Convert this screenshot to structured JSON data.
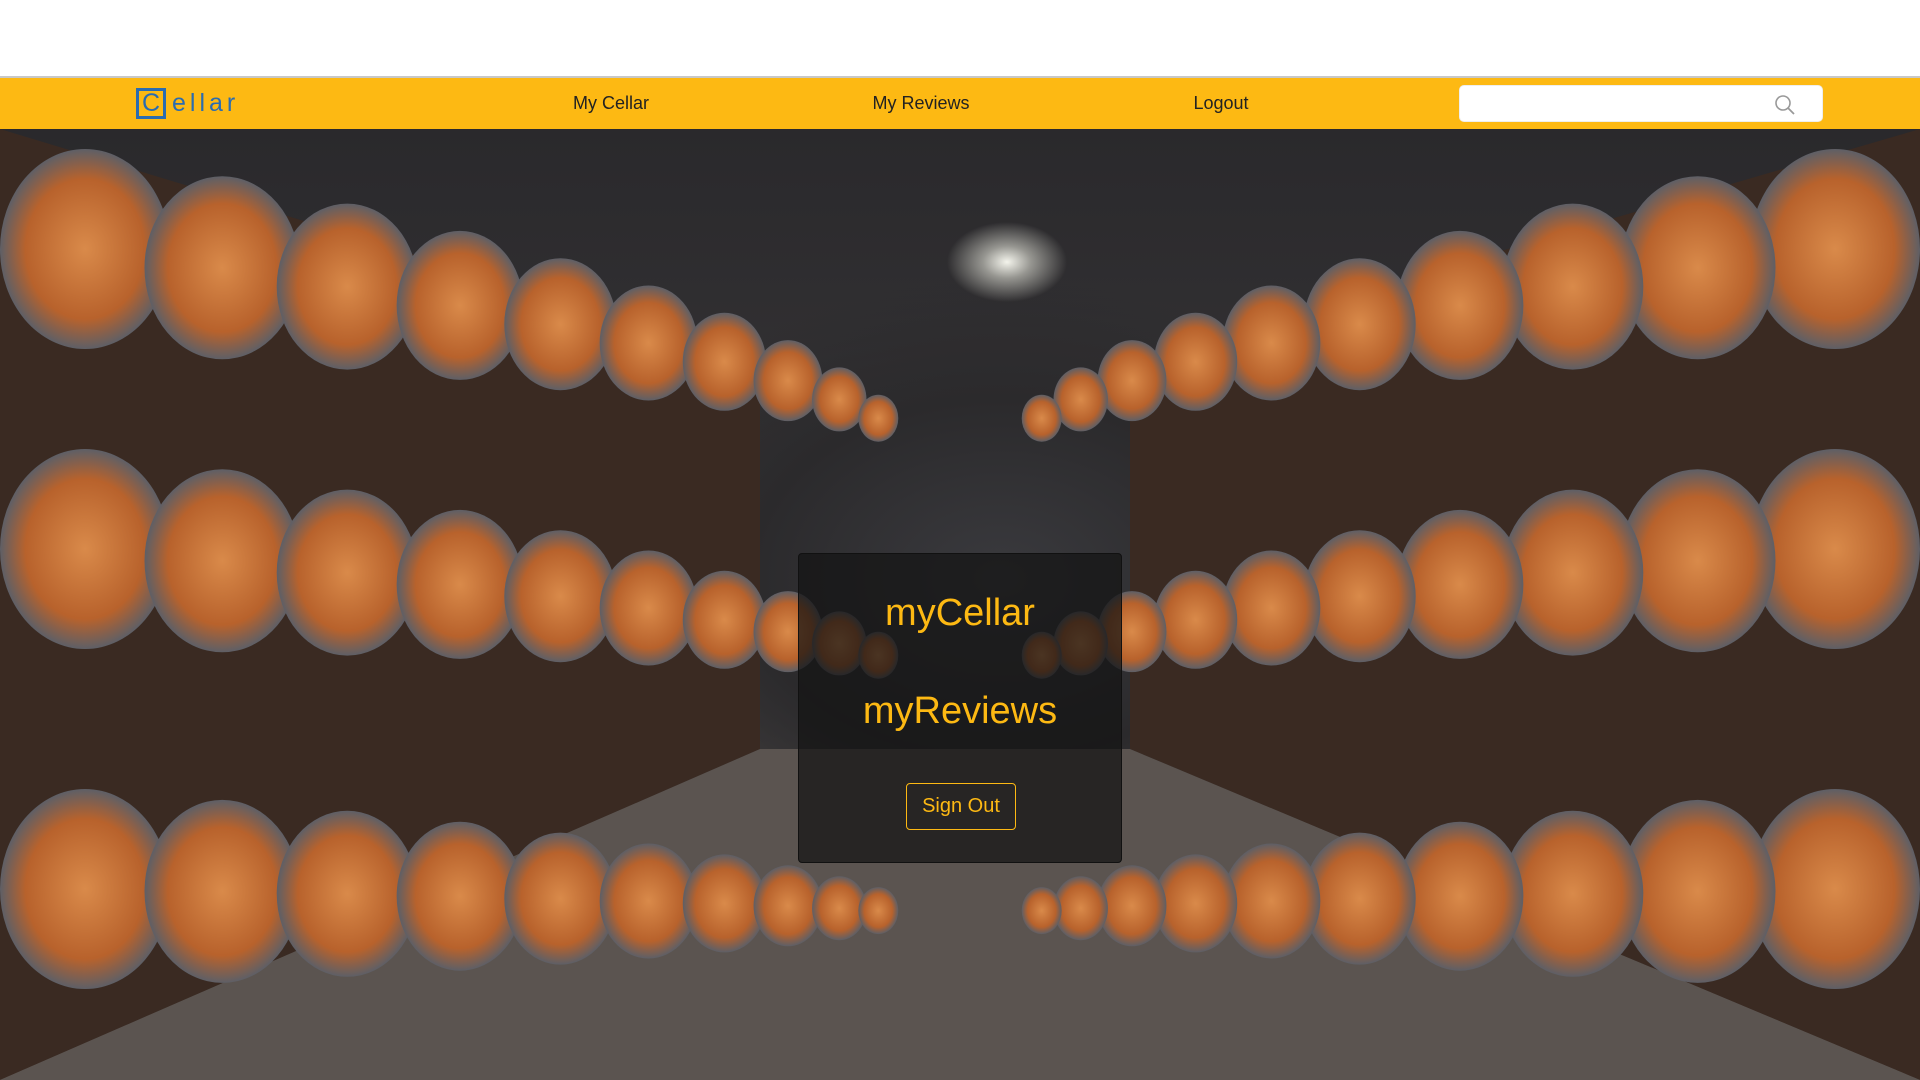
{
  "brand": {
    "logo_initial": "C",
    "logo_rest": "ellar",
    "accent": "#fdb913",
    "logo_color": "#2b6cb0"
  },
  "nav": {
    "links": [
      {
        "label": "My Cellar"
      },
      {
        "label": "My Reviews"
      },
      {
        "label": "Logout"
      }
    ]
  },
  "search": {
    "value": "",
    "placeholder": "",
    "icon": "search-icon"
  },
  "card": {
    "title1": "myCellar",
    "title2": "myReviews",
    "sign_out": "Sign Out"
  }
}
